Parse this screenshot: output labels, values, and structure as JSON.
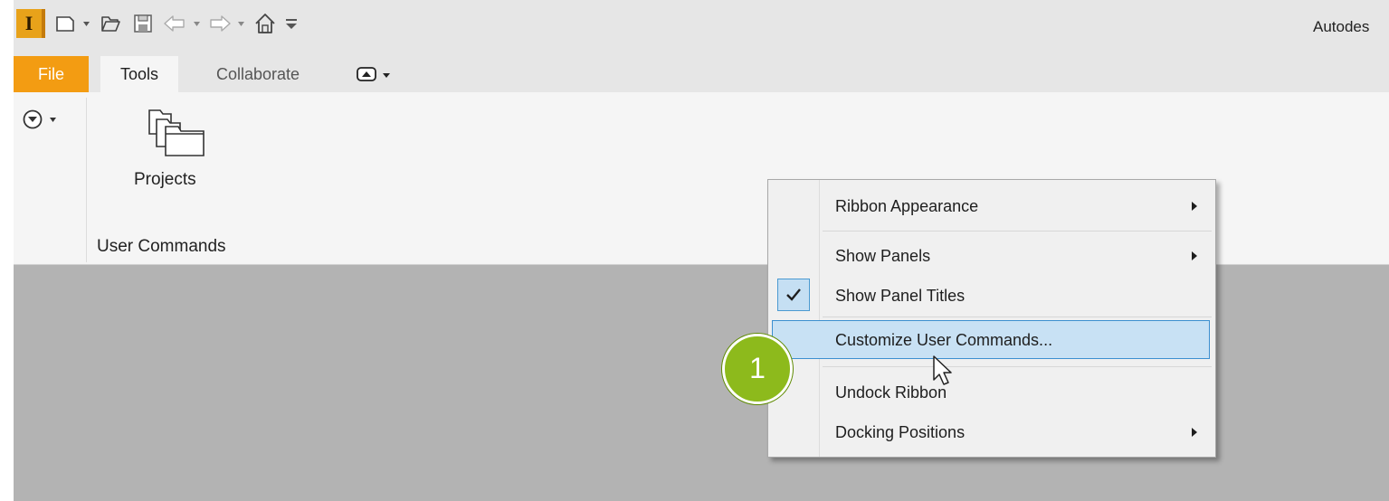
{
  "app": {
    "title_partial": "Autodes",
    "logo_letter": "I"
  },
  "quick_access": {
    "items": [
      "new-document-icon",
      "open-folder-icon",
      "save-icon",
      "undo-icon",
      "redo-icon",
      "home-icon",
      "customize-quick-access-icon"
    ]
  },
  "tabs": [
    {
      "label": "File",
      "active": false
    },
    {
      "label": "Tools",
      "active": true
    },
    {
      "label": "Collaborate",
      "active": false
    }
  ],
  "ribbon": {
    "buttons": [
      {
        "label": "Projects",
        "icon": "projects-icon"
      }
    ],
    "panel_title": "User Commands"
  },
  "context_menu": {
    "items": [
      {
        "label": "Ribbon Appearance",
        "submenu": true
      },
      {
        "label": "Show Panels",
        "submenu": true
      },
      {
        "label": "Show Panel Titles",
        "checked": true
      },
      {
        "label": "Customize User Commands...",
        "highlighted": true
      },
      {
        "label": "Undock Ribbon"
      },
      {
        "label": "Docking Positions",
        "submenu": true
      }
    ]
  },
  "callout": {
    "number": "1",
    "color": "#8dba1c"
  },
  "colors": {
    "file_tab": "#f39c12",
    "menu_highlight": "#c8e1f4",
    "menu_highlight_border": "#3c8fd0"
  }
}
